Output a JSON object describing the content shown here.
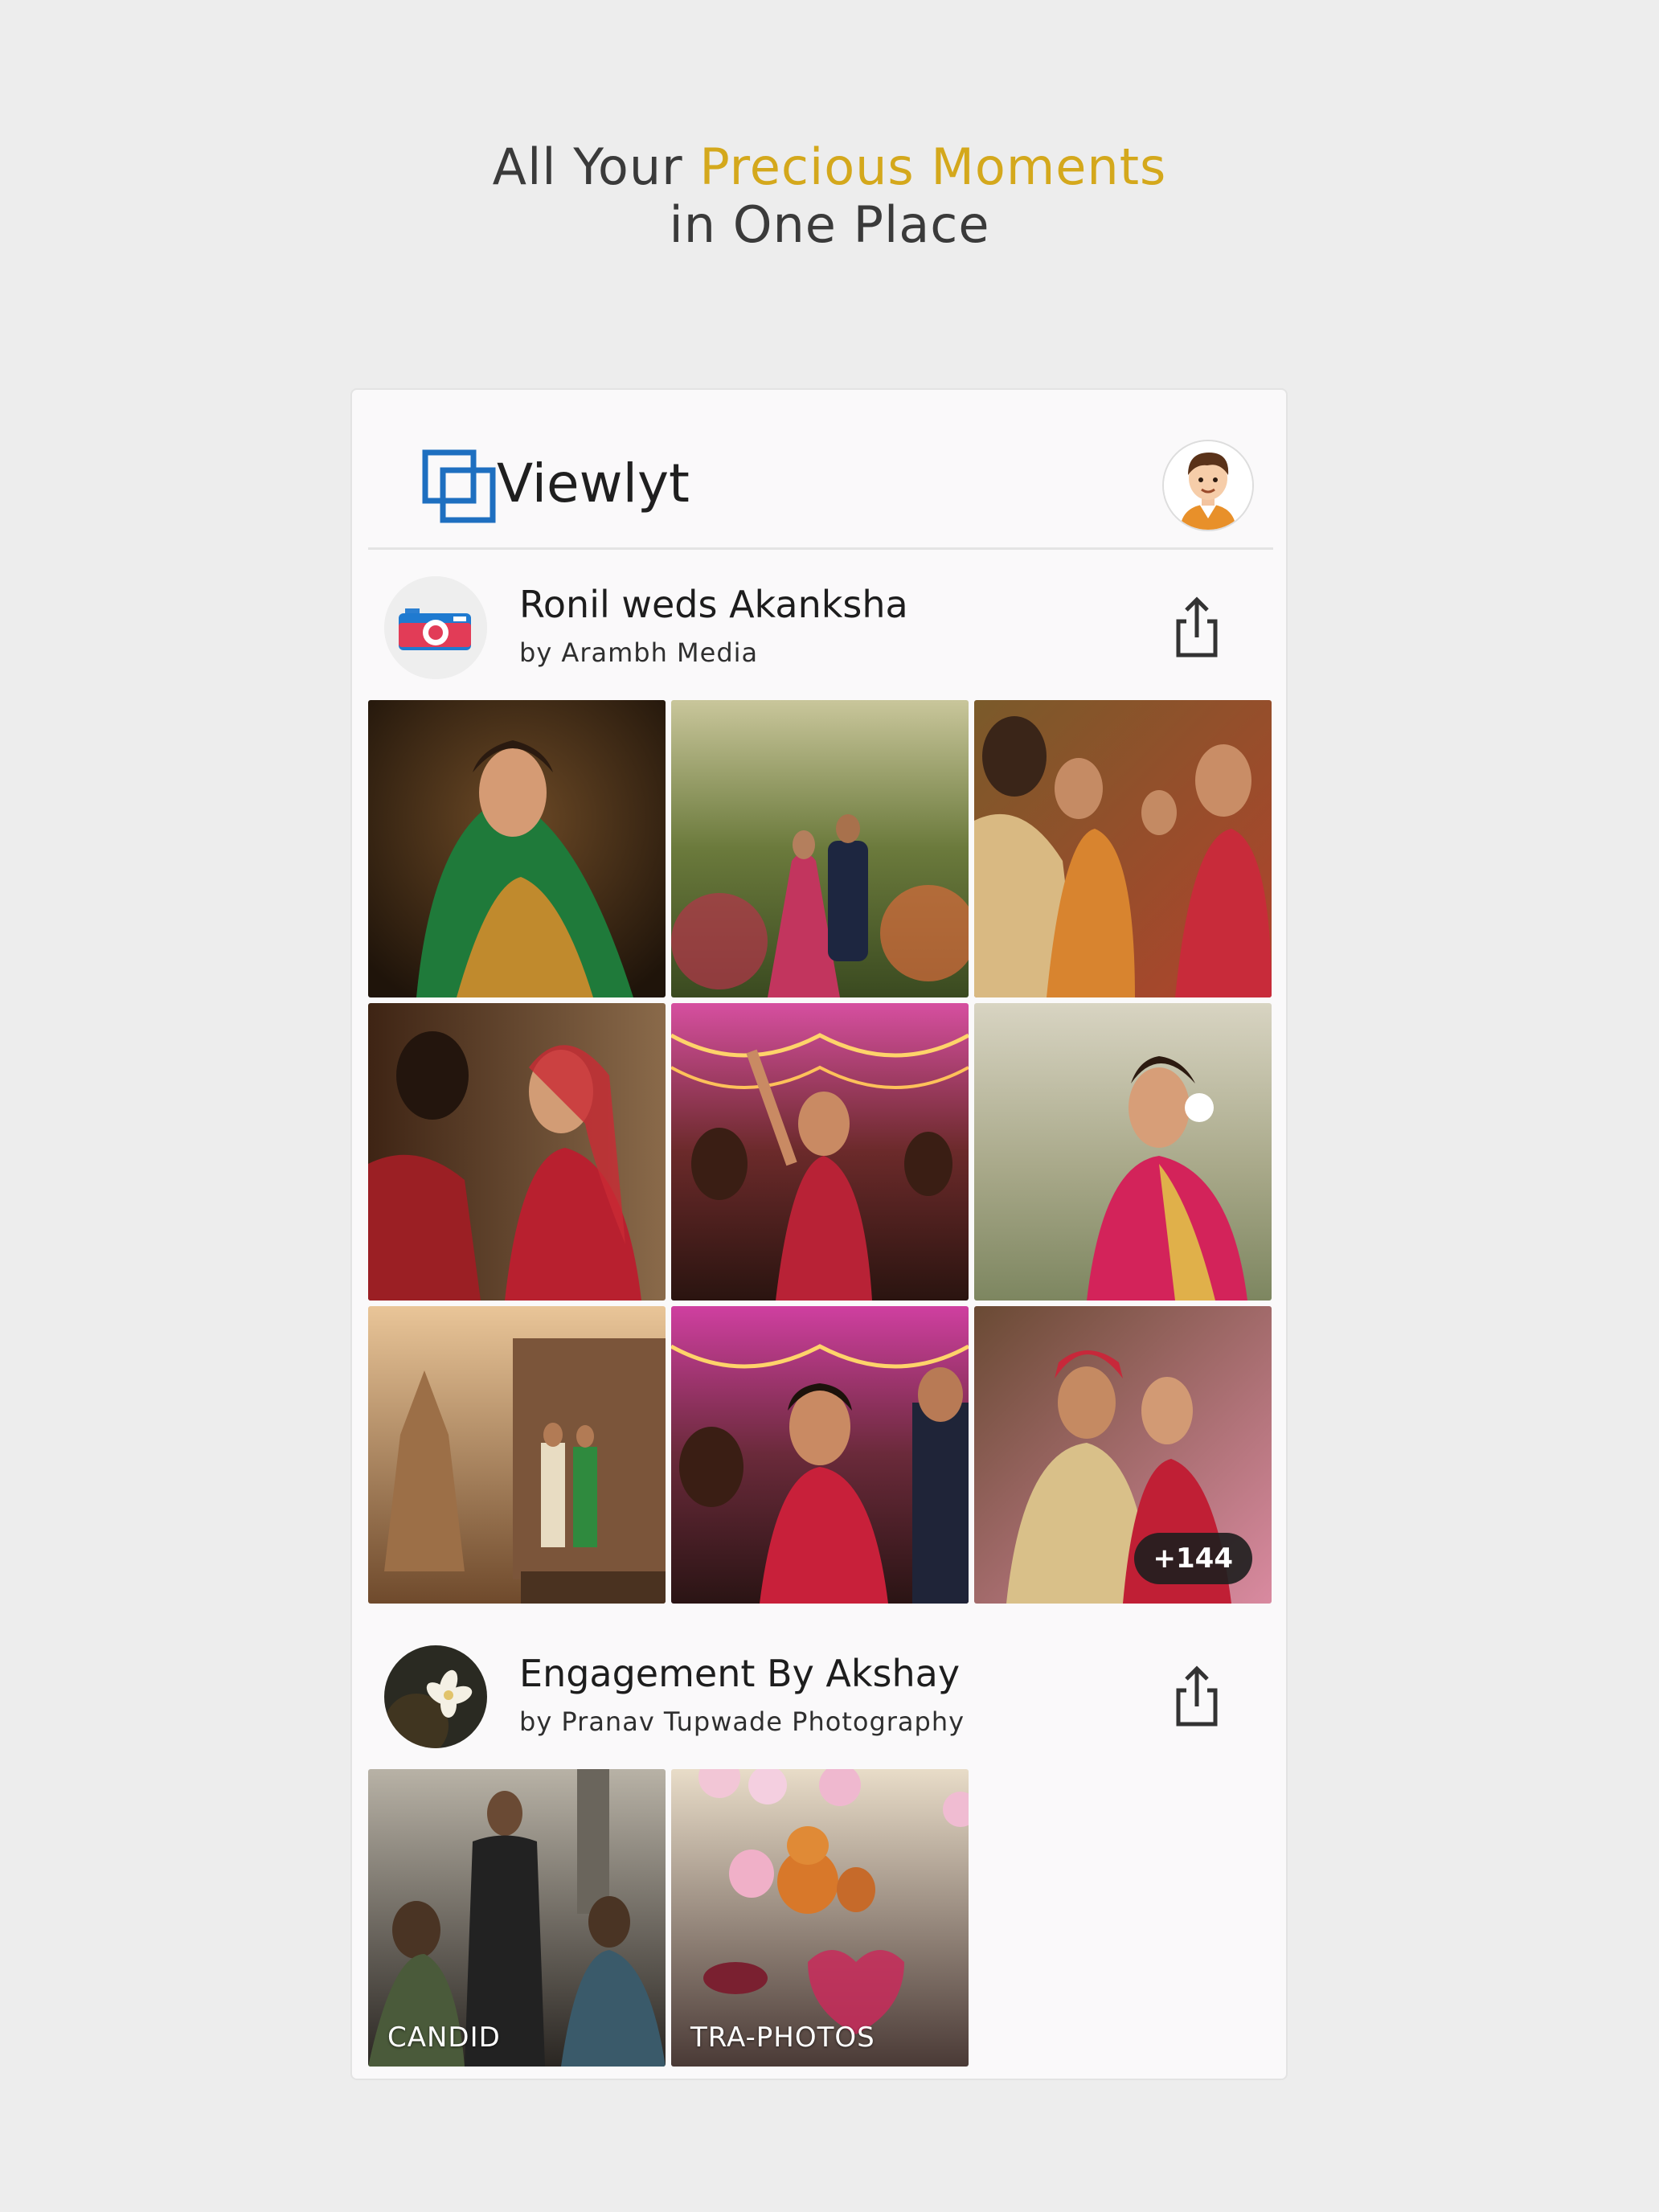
{
  "headline": {
    "part1": "All Your ",
    "accent": "Precious Moments",
    "line2": "in One Place",
    "accent_color": "#d4a81c"
  },
  "app": {
    "name": "Viewlyt",
    "logo_icon": "stacked-squares-icon",
    "avatar_icon": "user-avatar-icon"
  },
  "albums": [
    {
      "title": "Ronil weds Akanksha",
      "by": "by Arambh Media",
      "thumb_icon": "camera-logo-icon",
      "share_icon": "share-icon",
      "more_count": "+144",
      "photos": [
        {
          "name": "bride-green-saree-photo"
        },
        {
          "name": "couple-garden-walk-photo"
        },
        {
          "name": "ceremony-hands-photo"
        },
        {
          "name": "bride-red-lehenga-photo"
        },
        {
          "name": "sangeet-dance-photo"
        },
        {
          "name": "bride-outdoor-portrait-photo"
        },
        {
          "name": "temple-couple-photo"
        },
        {
          "name": "party-lights-photo"
        },
        {
          "name": "groom-bride-turban-photo"
        }
      ]
    },
    {
      "title": "Engagement By Akshay",
      "by": "by Pranav Tupwade Photography",
      "thumb_icon": "flower-photo-icon",
      "share_icon": "share-icon",
      "photos": [
        {
          "name": "candid-folder-photo",
          "label": "CANDID"
        },
        {
          "name": "tra-photos-folder-photo",
          "label": "TRA-PHOTOS"
        }
      ]
    }
  ]
}
